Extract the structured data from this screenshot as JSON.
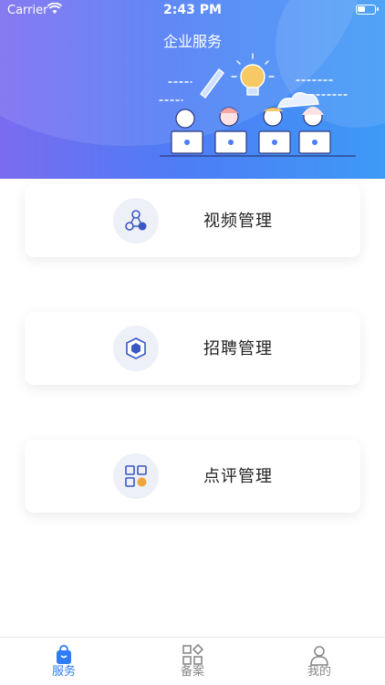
{
  "status_bar": {
    "carrier": "Carrier",
    "time": "2:43 PM"
  },
  "header": {
    "title": "企业服务"
  },
  "cards": [
    {
      "label": "视频管理",
      "icon": "video-network-icon"
    },
    {
      "label": "招聘管理",
      "icon": "recruit-cube-icon"
    },
    {
      "label": "点评管理",
      "icon": "review-grid-icon"
    }
  ],
  "tabbar": {
    "items": [
      {
        "label": "服务",
        "icon": "shopping-bag-icon",
        "active": true
      },
      {
        "label": "备案",
        "icon": "grid-diamond-icon",
        "active": false
      },
      {
        "label": "我的",
        "icon": "user-icon",
        "active": false
      }
    ]
  },
  "colors": {
    "accent": "#2f7cf6",
    "header_start": "#7a6cf0",
    "header_end": "#3d9af6"
  }
}
